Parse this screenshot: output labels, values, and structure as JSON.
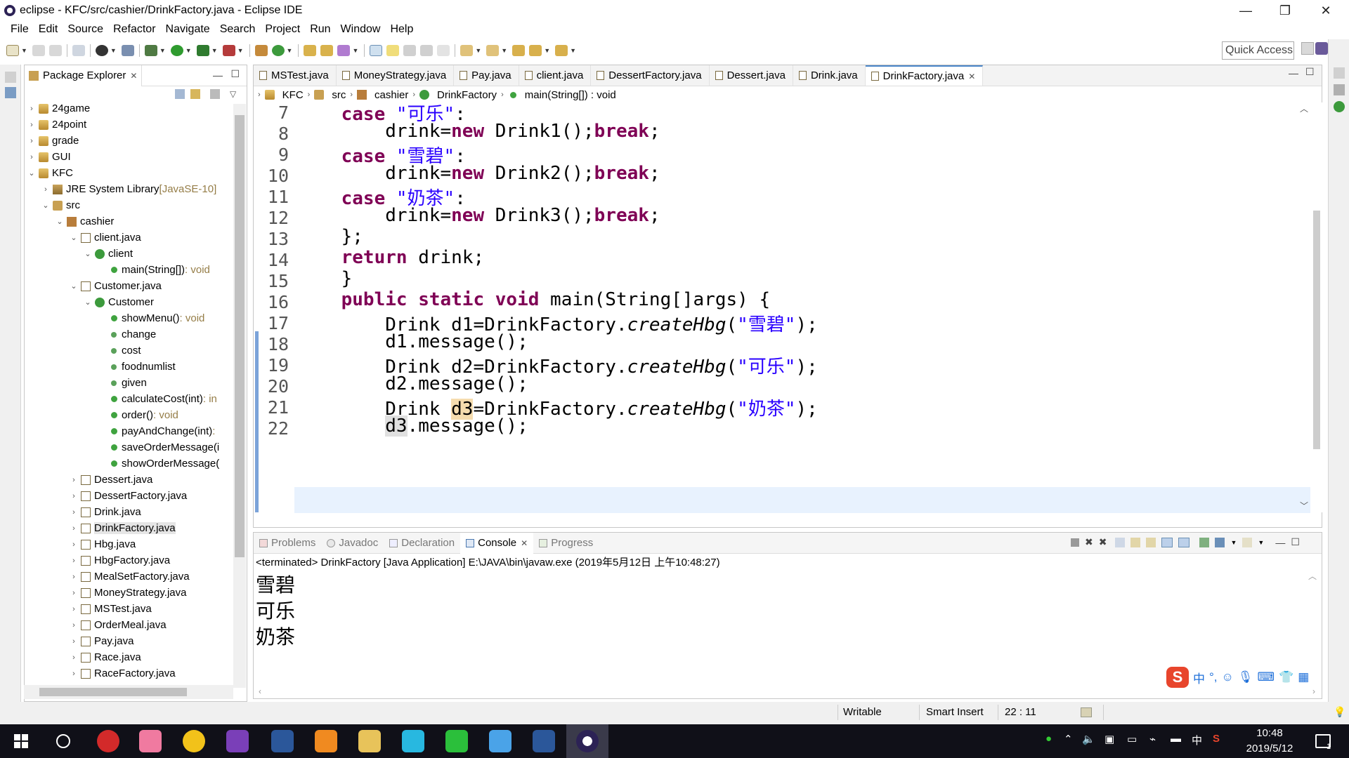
{
  "window": {
    "title": "eclipse - KFC/src/cashier/DrinkFactory.java - Eclipse IDE",
    "minimize": "—",
    "restore": "❐",
    "close": "✕"
  },
  "menu": [
    "File",
    "Edit",
    "Source",
    "Refactor",
    "Navigate",
    "Search",
    "Project",
    "Run",
    "Window",
    "Help"
  ],
  "quick_access": "Quick Access",
  "package_explorer": {
    "title": "Package Explorer",
    "close": "✕",
    "tree": [
      {
        "label": "24game",
        "suffix": ""
      },
      {
        "label": "24point",
        "suffix": ""
      },
      {
        "label": "grade",
        "suffix": ""
      },
      {
        "label": "GUI",
        "suffix": ""
      },
      {
        "label": "KFC",
        "suffix": ""
      },
      {
        "label": "JRE System Library",
        "suffix": " [JavaSE-10]"
      },
      {
        "label": "src",
        "suffix": ""
      },
      {
        "label": "cashier",
        "suffix": ""
      },
      {
        "label": "client.java",
        "suffix": ""
      },
      {
        "label": "client",
        "suffix": ""
      },
      {
        "label": "main(String[])",
        "suffix": " : void"
      },
      {
        "label": "Customer.java",
        "suffix": ""
      },
      {
        "label": "Customer",
        "suffix": ""
      },
      {
        "label": "showMenu()",
        "suffix": " : void"
      },
      {
        "label": "change",
        "suffix": ""
      },
      {
        "label": "cost",
        "suffix": ""
      },
      {
        "label": "foodnumlist",
        "suffix": ""
      },
      {
        "label": "given",
        "suffix": ""
      },
      {
        "label": "calculateCost(int)",
        "suffix": " : in"
      },
      {
        "label": "order()",
        "suffix": " : void"
      },
      {
        "label": "payAndChange(int)",
        "suffix": " :"
      },
      {
        "label": "saveOrderMessage(i",
        "suffix": ""
      },
      {
        "label": "showOrderMessage(",
        "suffix": ""
      },
      {
        "label": "Dessert.java",
        "suffix": ""
      },
      {
        "label": "DessertFactory.java",
        "suffix": ""
      },
      {
        "label": "Drink.java",
        "suffix": ""
      },
      {
        "label": "DrinkFactory.java",
        "suffix": ""
      },
      {
        "label": "Hbg.java",
        "suffix": ""
      },
      {
        "label": "HbgFactory.java",
        "suffix": ""
      },
      {
        "label": "MealSetFactory.java",
        "suffix": ""
      },
      {
        "label": "MoneyStrategy.java",
        "suffix": ""
      },
      {
        "label": "MSTest.java",
        "suffix": ""
      },
      {
        "label": "OrderMeal.java",
        "suffix": ""
      },
      {
        "label": "Pay.java",
        "suffix": ""
      },
      {
        "label": "Race.java",
        "suffix": ""
      },
      {
        "label": "RaceFactory.java",
        "suffix": ""
      }
    ]
  },
  "editor_tabs": [
    "MSTest.java",
    "MoneyStrategy.java",
    "Pay.java",
    "client.java",
    "DessertFactory.java",
    "Dessert.java",
    "Drink.java",
    "DrinkFactory.java"
  ],
  "active_tab_close": "✕",
  "breadcrumb": [
    "KFC",
    "src",
    "cashier",
    "DrinkFactory",
    "main(String[]) : void"
  ],
  "code": {
    "line_numbers": [
      "7",
      "8",
      "9",
      "10",
      "11",
      "12",
      "13",
      "14",
      "15",
      "16",
      "17",
      "18",
      "19",
      "20",
      "21",
      "22"
    ],
    "l7": {
      "kw": "case",
      "str": "\"可乐\"",
      "rest": ":"
    },
    "l8": {
      "a": "drink=",
      "kw": "new",
      "b": " Drink1();",
      "kw2": "break",
      "c": ";"
    },
    "l9": {
      "kw": "case",
      "str": "\"雪碧\"",
      "rest": ":"
    },
    "l10": {
      "a": "drink=",
      "kw": "new",
      "b": " Drink2();",
      "kw2": "break",
      "c": ";"
    },
    "l11": {
      "kw": "case",
      "str": "\"奶茶\"",
      "rest": ":"
    },
    "l12": {
      "a": "drink=",
      "kw": "new",
      "b": " Drink3();",
      "kw2": "break",
      "c": ";"
    },
    "l13": "};",
    "l14": {
      "kw": "return",
      "rest": " drink;"
    },
    "l15": "}",
    "l16": {
      "kw": "public static void",
      "rest": " main(String[]args) {"
    },
    "l17": {
      "a": "Drink d1=DrinkFactory.",
      "m": "createHbg",
      "b": "(",
      "str": "\"雪碧\"",
      "c": ");"
    },
    "l18": "d1.message();",
    "l19": {
      "a": "Drink d2=DrinkFactory.",
      "m": "createHbg",
      "b": "(",
      "str": "\"可乐\"",
      "c": ");"
    },
    "l20": "d2.message();",
    "l21": {
      "a": "Drink ",
      "hl": "d3",
      "b": "=DrinkFactory.",
      "m": "createHbg",
      "c": "(",
      "str": "\"奶茶\"",
      "d": ");"
    },
    "l22": {
      "hl": "d3",
      "rest": ".message();"
    }
  },
  "console_tabs": [
    "Problems",
    "Javadoc",
    "Declaration",
    "Console",
    "Progress"
  ],
  "console_header": "<terminated> DrinkFactory [Java Application] E:\\JAVA\\bin\\javaw.exe (2019年5月12日 上午10:48:27)",
  "console_output": [
    "雪碧",
    "可乐",
    "奶茶"
  ],
  "ime": {
    "logo": "S",
    "lang": "中"
  },
  "status": {
    "writable": "Writable",
    "insert_mode": "Smart Insert",
    "position": "22 : 11"
  },
  "taskbar": {
    "time": "10:48",
    "date": "2019/5/12",
    "ime_lang": "中",
    "notifications": "1"
  },
  "colors": {
    "keyword": "#7f0055",
    "string": "#2a00ff",
    "current_line": "#e8f2fe",
    "occurrence": "#f5dcae"
  }
}
